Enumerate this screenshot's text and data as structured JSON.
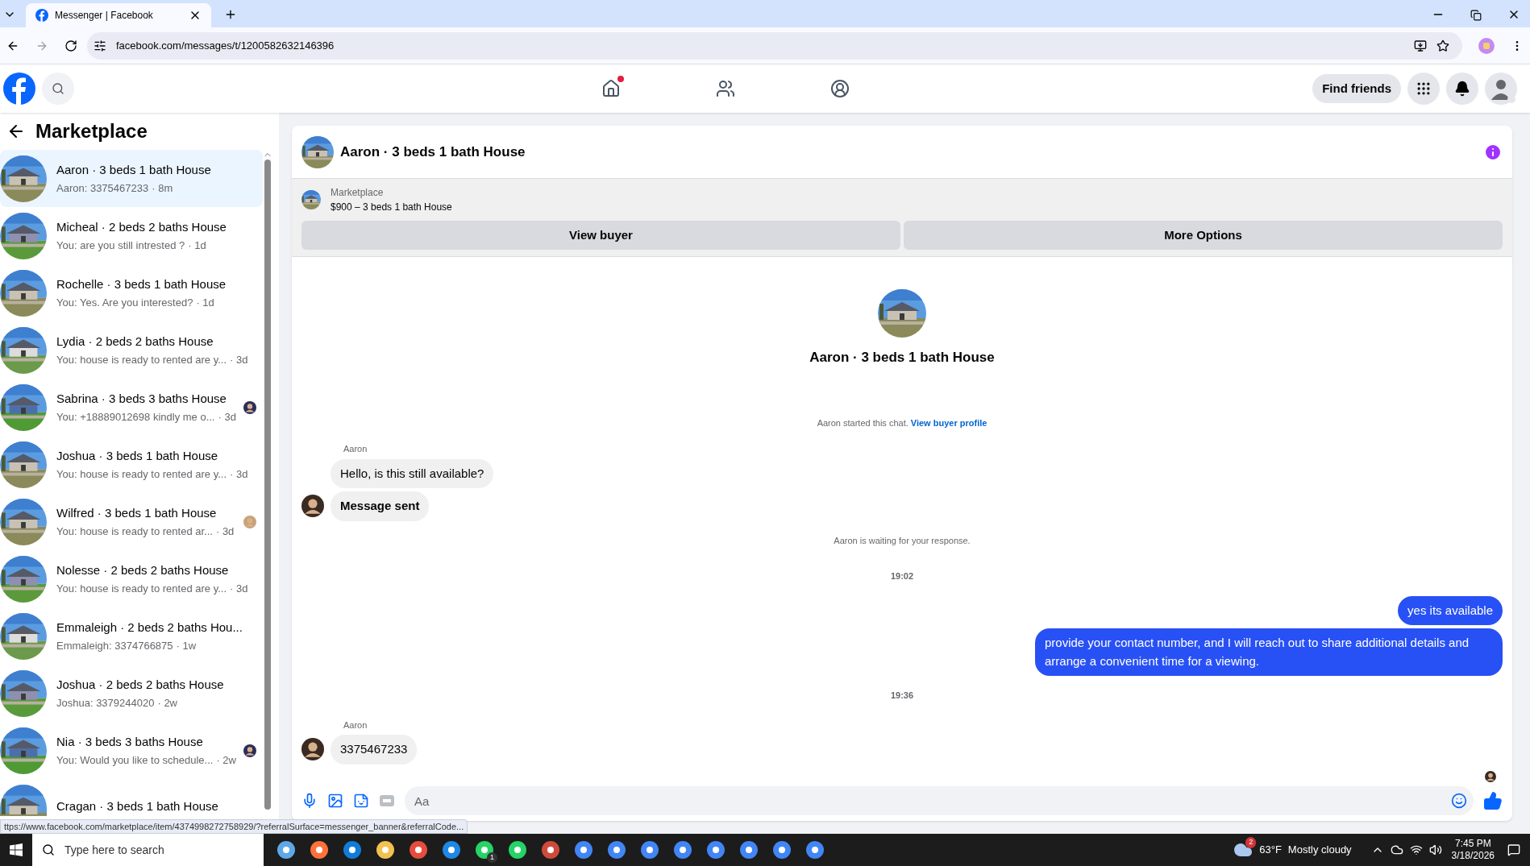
{
  "browser": {
    "tab_title": "Messenger | Facebook",
    "url": "facebook.com/messages/t/1200582632146396"
  },
  "header": {
    "nav": [
      {
        "kind": "home",
        "dot": true
      },
      {
        "kind": "friends",
        "dot": false
      },
      {
        "kind": "groups",
        "dot": false
      }
    ],
    "find_friends": "Find friends"
  },
  "sidebar": {
    "title": "Marketplace",
    "items": [
      {
        "title": "Aaron · 3 beds 1 bath House",
        "preview": "Aaron: 3375467233",
        "time": "· 8m",
        "selected": true,
        "seen": false
      },
      {
        "title": "Micheal · 2 beds 2 baths House",
        "preview": "You: are you still intrested ?",
        "time": "· 1d",
        "selected": false,
        "seen": false
      },
      {
        "title": "Rochelle · 3 beds 1 bath House",
        "preview": "You: Yes. Are you interested?",
        "time": "· 1d",
        "selected": false,
        "seen": false
      },
      {
        "title": "Lydia · 2 beds 2 baths House",
        "preview": "You: house is ready to rented are y...",
        "time": "· 3d",
        "selected": false,
        "seen": false
      },
      {
        "title": "Sabrina · 3 beds 3 baths House",
        "preview": "You: +18889012698 kindly me o...",
        "time": "· 3d",
        "selected": false,
        "seen": true
      },
      {
        "title": "Joshua · 3 beds 1 bath House",
        "preview": "You: house is ready to rented are y...",
        "time": "· 3d",
        "selected": false,
        "seen": false
      },
      {
        "title": "Wilfred · 3 beds 1 bath House",
        "preview": "You: house is ready to rented ar...",
        "time": "· 3d",
        "selected": false,
        "seen": true
      },
      {
        "title": "Nolesse · 2 beds 2 baths House",
        "preview": "You: house is ready to rented are y...",
        "time": "· 3d",
        "selected": false,
        "seen": false
      },
      {
        "title": "Emmaleigh · 2 beds 2 baths Hou...",
        "preview": "Emmaleigh: 3374766875",
        "time": "· 1w",
        "selected": false,
        "seen": false
      },
      {
        "title": "Joshua · 2 beds 2 baths House",
        "preview": "Joshua: 3379244020",
        "time": "· 2w",
        "selected": false,
        "seen": false
      },
      {
        "title": "Nia · 3 beds 3 baths House",
        "preview": "You: Would you like to schedule...",
        "time": "· 2w",
        "selected": false,
        "seen": true
      },
      {
        "title": "Cragan · 3 beds 1 bath House",
        "selected": false,
        "seen": false
      }
    ]
  },
  "chat": {
    "title": "Aaron · 3 beds 1 bath House",
    "listing": {
      "label": "Marketplace",
      "price_title": "$900 – 3 beds 1 bath House"
    },
    "buttons": [
      "View buyer",
      "More Options"
    ],
    "intro_title": "Aaron · 3 beds 1 bath House",
    "intro_text": "Aaron started this chat.",
    "intro_link": "View buyer profile",
    "messages": [
      {
        "kind": "sender",
        "text": "Aaron"
      },
      {
        "kind": "incoming",
        "text": "Hello, is this still available?",
        "bold": false,
        "avatar": false
      },
      {
        "kind": "incoming",
        "text": "Message sent",
        "bold": true,
        "avatar": true
      },
      {
        "kind": "system",
        "text": "Aaron is waiting for your response."
      },
      {
        "kind": "time",
        "text": "19:02"
      },
      {
        "kind": "outgoing",
        "text": "yes its available"
      },
      {
        "kind": "outgoing",
        "text": "provide your contact number, and I will reach out to share additional details and arrange a convenient time for a viewing."
      },
      {
        "kind": "time",
        "text": "19:36"
      },
      {
        "kind": "sender",
        "text": "Aaron"
      },
      {
        "kind": "incoming",
        "text": "3375467233",
        "bold": false,
        "avatar": true
      }
    ],
    "composer_placeholder": "Aa"
  },
  "status_url": "ttps://www.facebook.com/marketplace/item/4374998272758929/?referralSurface=messenger_banner&referralCode...",
  "taskbar": {
    "search_placeholder": "Type here to search",
    "whatsapp_badge": "1",
    "weather_badge": "2",
    "temperature": "63°F",
    "weather": "Mostly cloudy",
    "time": "7:45 PM",
    "date": "3/18/2026"
  }
}
